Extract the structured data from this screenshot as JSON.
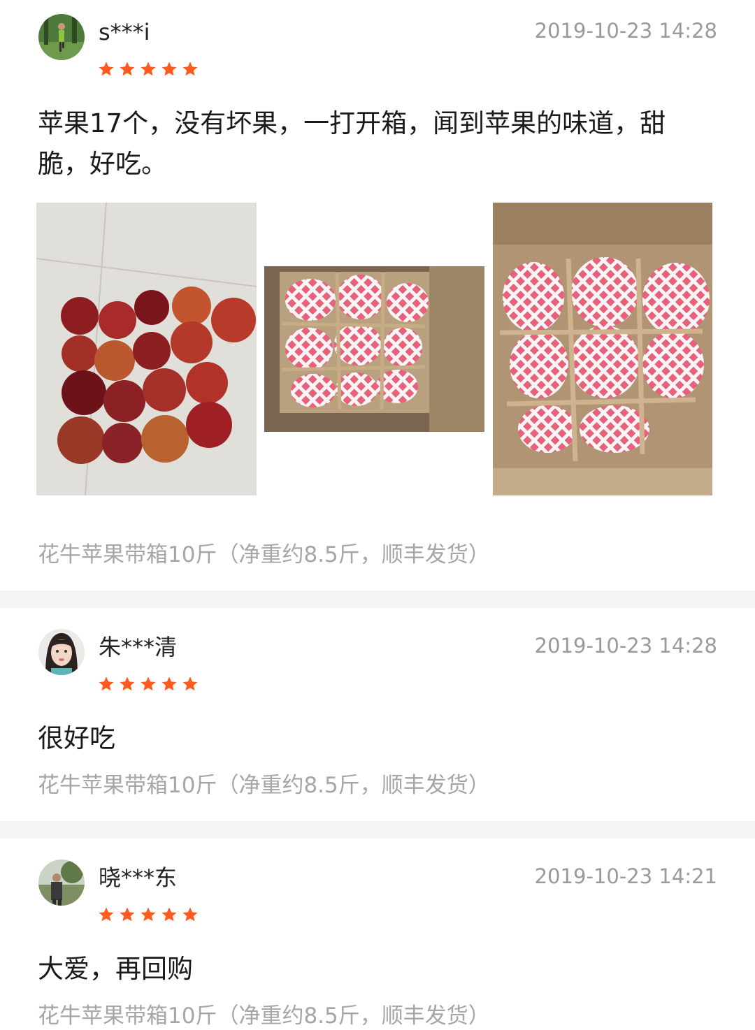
{
  "colors": {
    "star": "#ff5a1f",
    "separator": "#f4f4f6",
    "meta_text": "#9a9a9a"
  },
  "reviews": [
    {
      "username": "s***i",
      "time": "2019-10-23 14:28",
      "rating": 5,
      "content": "苹果17个，没有坏果，一打开箱，闻到苹果的味道，甜脆，好吃。",
      "spec": "花牛苹果带箱10斤（净重约8.5斤，顺丰发货）",
      "photo_count": 3
    },
    {
      "username": "朱***清",
      "time": "2019-10-23 14:28",
      "rating": 5,
      "content": "很好吃",
      "spec": "花牛苹果带箱10斤（净重约8.5斤，顺丰发货）"
    },
    {
      "username": "晓***东",
      "time": "2019-10-23 14:21",
      "rating": 5,
      "content": "大爱，再回购",
      "spec": "花牛苹果带箱10斤（净重约8.5斤，顺丰发货）"
    }
  ]
}
